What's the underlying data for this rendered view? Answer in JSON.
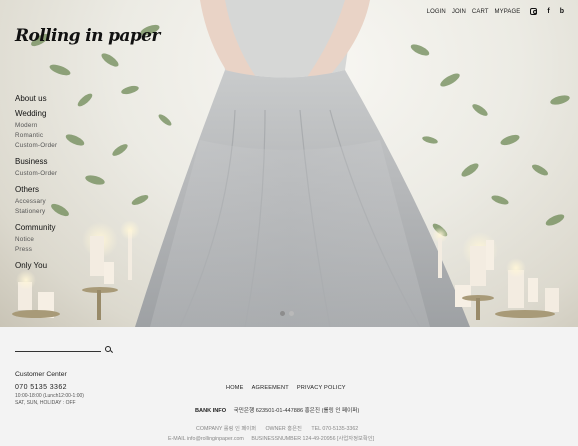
{
  "brand": {
    "logo": "Rolling in paper"
  },
  "topnav": [
    "LOGIN",
    "JOIN",
    "CART",
    "MYPAGE"
  ],
  "social": [
    {
      "name": "instagram-icon",
      "glyph": ""
    },
    {
      "name": "facebook-icon",
      "glyph": "f"
    },
    {
      "name": "blog-icon",
      "glyph": "b"
    }
  ],
  "menu": {
    "about": "About us",
    "wedding": {
      "label": "Wedding",
      "items": [
        "Modern",
        "Romantic",
        "Custom-Order"
      ]
    },
    "business": {
      "label": "Business",
      "items": [
        "Custom-Order"
      ]
    },
    "others": {
      "label": "Others",
      "items": [
        "Accessary",
        "Stationery"
      ]
    },
    "community": {
      "label": "Community",
      "items": [
        "Notice",
        "Press"
      ]
    },
    "only": "Only You"
  },
  "slider": {
    "active": 1,
    "count": 2
  },
  "footer": {
    "customer_center": "Customer Center",
    "phone": "070 5135 3362",
    "hours1": "10:00-18:00 (Lunch12:00-1:00)",
    "hours2": "SAT, SUN, HOLIDAY : OFF",
    "links": [
      "HOME",
      "AGREEMENT",
      "PRIVACY POLICY"
    ],
    "bank_label": "BANK INFO",
    "bank_value": "국민은행 623501-01-447886 홍은진 (롤링 인 페이퍼)",
    "company": "COMPANY 롤링 인 페이퍼",
    "owner": "OWNER 홍은진",
    "tel": "TEL 070-5135-3362",
    "email": "E-MAIL info@rollinginpaper.com",
    "business_no": "BUSINESSNUMBER 124-49-20956 [사업자정보확인]"
  },
  "colors": {
    "footer_bg": "#f3f3f3",
    "text_dark": "#222222",
    "text_muted": "#888888"
  }
}
